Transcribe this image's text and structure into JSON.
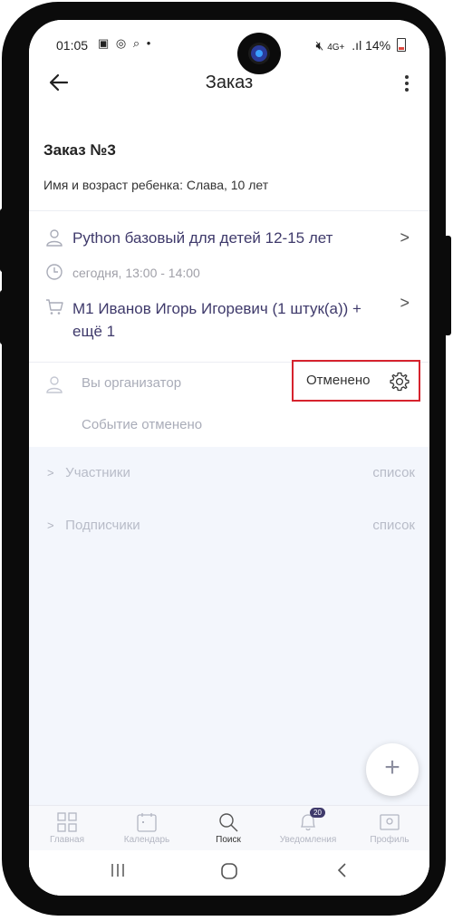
{
  "status_bar": {
    "time": "01:05",
    "network": "4G+",
    "battery": "14%"
  },
  "header": {
    "title": "Заказ"
  },
  "order": {
    "title": "Заказ №3",
    "child_info": "Имя и возраст ребенка: Слава, 10 лет",
    "course": "Python базовый для детей 12-15 лет",
    "time": "сегодня, 13:00 - 14:00",
    "cart": "М1 Иванов Игорь Игоревич (1 штук(а)) + ещё 1"
  },
  "organizer": {
    "label": "Вы организатор",
    "status": "Отменено",
    "event_status": "Событие отменено"
  },
  "sections": [
    {
      "label": "Участники",
      "action": "список"
    },
    {
      "label": "Подписчики",
      "action": "список"
    }
  ],
  "fab": {
    "label": "+"
  },
  "bottom_nav": [
    {
      "label": "Главная",
      "icon": "home-grid-icon"
    },
    {
      "label": "Календарь",
      "icon": "calendar-icon"
    },
    {
      "label": "Поиск",
      "icon": "search-icon",
      "active": true
    },
    {
      "label": "Уведомления",
      "icon": "bell-icon",
      "badge": "20"
    },
    {
      "label": "Профиль",
      "icon": "profile-icon"
    }
  ],
  "colors": {
    "accent": "#3f3a6b",
    "highlight_border": "#d6232e",
    "lower_bg": "#f3f6fc"
  }
}
